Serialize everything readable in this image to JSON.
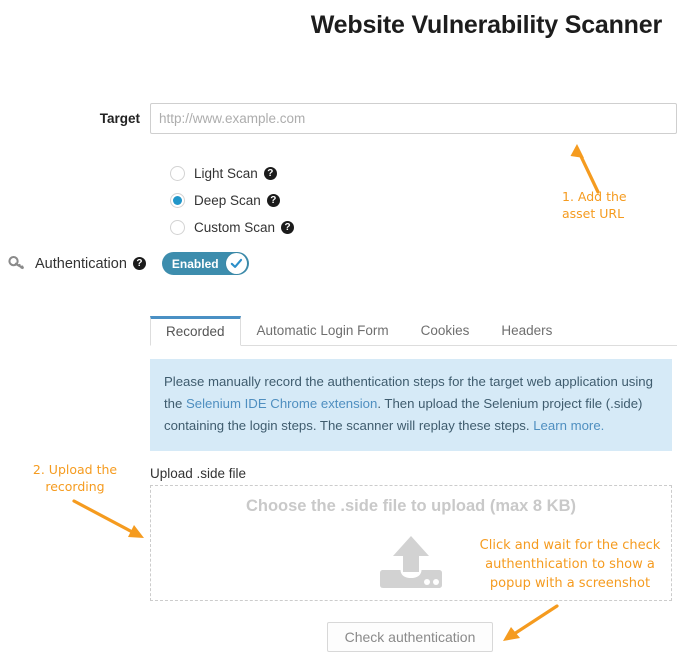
{
  "header": {
    "title": "Website Vulnerability Scanner"
  },
  "target": {
    "label": "Target",
    "placeholder": "http://www.example.com",
    "value": ""
  },
  "scan_options": {
    "selected": "deep",
    "items": [
      {
        "id": "light",
        "label": "Light Scan",
        "checked": false,
        "help": "?"
      },
      {
        "id": "deep",
        "label": "Deep Scan",
        "checked": true,
        "help": "?"
      },
      {
        "id": "custom",
        "label": "Custom Scan",
        "checked": false,
        "help": "?"
      }
    ]
  },
  "authentication": {
    "icon": "key-icon",
    "label": "Authentication",
    "help": "?",
    "toggle": {
      "state_label": "Enabled",
      "checked": true
    }
  },
  "tabs": [
    {
      "id": "recorded",
      "label": "Recorded",
      "active": true
    },
    {
      "id": "automatic-login-form",
      "label": "Automatic Login Form",
      "active": false
    },
    {
      "id": "cookies",
      "label": "Cookies",
      "active": false
    },
    {
      "id": "headers",
      "label": "Headers",
      "active": false
    }
  ],
  "info_box": {
    "part1": "Please manually record the authentication steps for the target web application using the ",
    "link1": "Selenium IDE Chrome extension",
    "part2": ". Then upload the Selenium project file (.side) containing the login steps. The scanner will replay these steps. ",
    "link2": "Learn more."
  },
  "upload": {
    "label": "Upload .side file",
    "dropzone_text": "Choose the .side file to upload (max 8 KB)",
    "icon": "upload-cloud-icon"
  },
  "actions": {
    "check_auth_label": "Check authentication"
  },
  "annotations": {
    "step1": "1. Add the\nasset URL",
    "step2": "2. Upload the\nrecording",
    "step3": "Click and wait for the check authenthication to show a popup with a screenshot"
  },
  "colors": {
    "accent_blue": "#2196c9",
    "toggle_blue": "#3d8dad",
    "tab_active_border": "#4a90c4",
    "info_bg": "#d6eaf7",
    "info_link": "#4f8fc0",
    "annotation_orange": "#F59B1F",
    "dropzone_gray": "#c9c9c9"
  }
}
